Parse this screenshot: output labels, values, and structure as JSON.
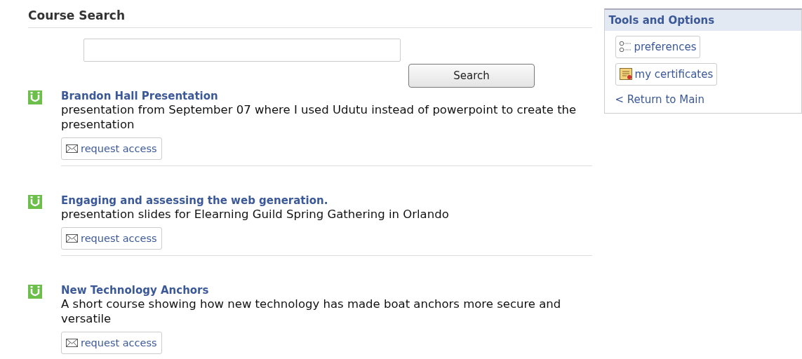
{
  "heading": "Course Search",
  "search": {
    "button": "Search"
  },
  "courses": [
    {
      "title": "Brandon Hall Presentation",
      "description": "presentation from September 07 where I used Udutu instead of powerpoint to create the presentation",
      "action": "request access"
    },
    {
      "title": "Engaging and assessing the web generation.",
      "description": "presentation slides for Elearning Guild Spring Gathering in Orlando",
      "action": "request access"
    },
    {
      "title": "New Technology Anchors",
      "description": "A short course showing how new technology has made boat anchors more secure and versatile",
      "action": "request access"
    }
  ],
  "sidebar": {
    "title": "Tools and Options",
    "items": [
      {
        "kind": "button",
        "label": "preferences"
      },
      {
        "kind": "button",
        "label": "my certificates"
      },
      {
        "kind": "link",
        "label": "< Return to Main"
      }
    ]
  }
}
